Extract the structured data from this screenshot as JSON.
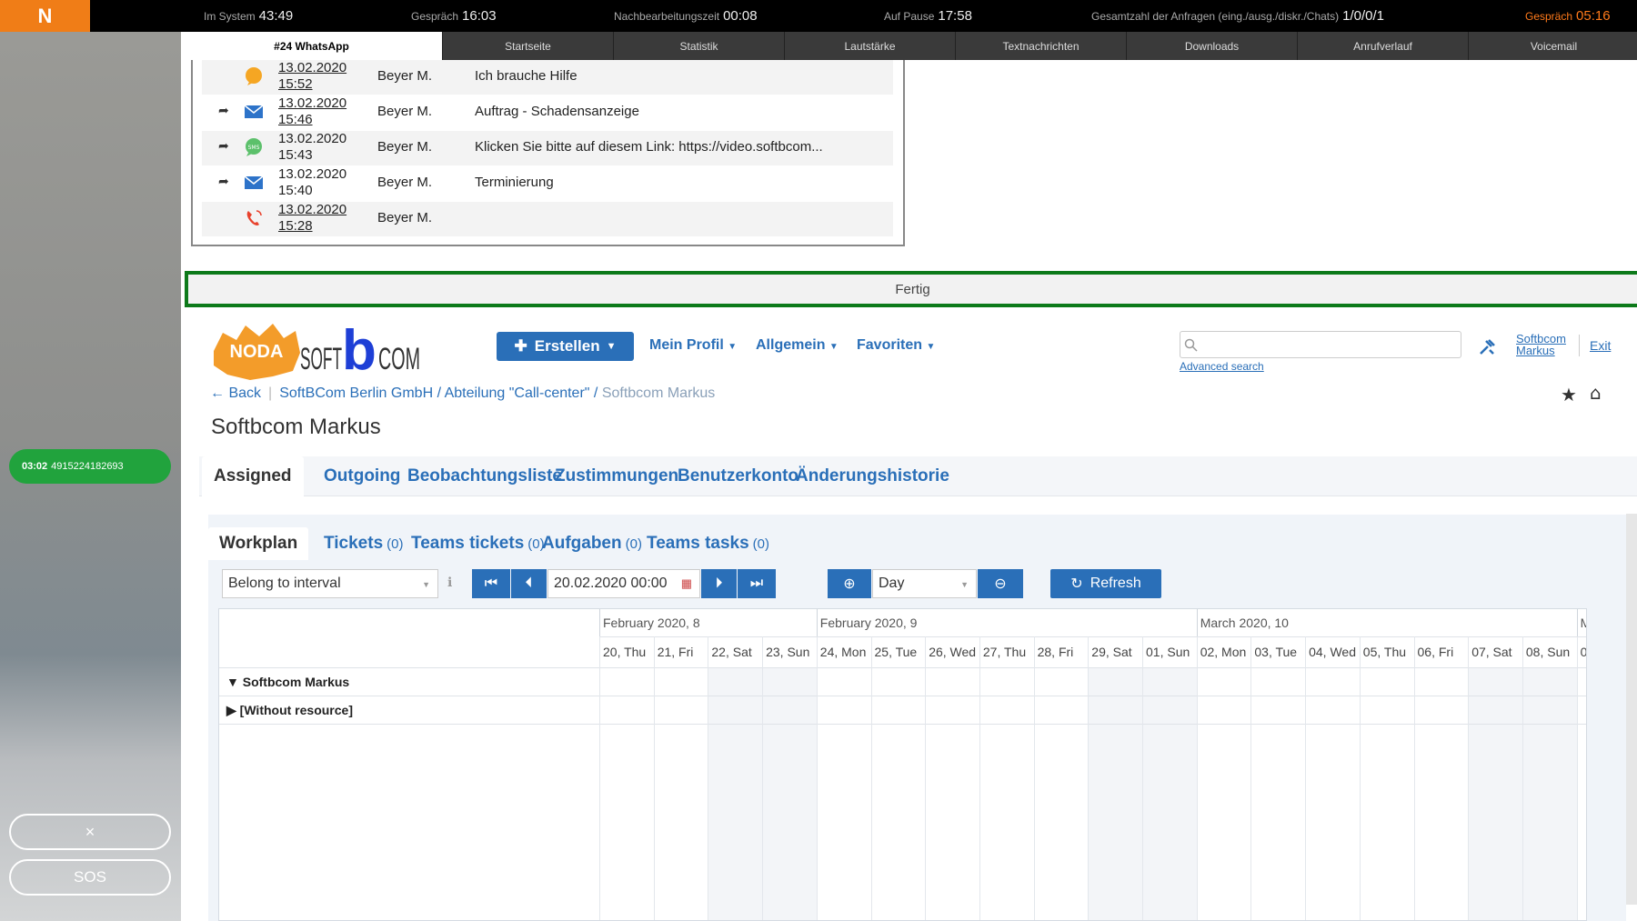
{
  "topbar": {
    "in_system_label": "Im System",
    "in_system_value": "43:49",
    "call_label": "Gespräch",
    "call_value": "16:03",
    "wrapup_label": "Nachbearbeitungszeit",
    "wrapup_value": "00:08",
    "pause_label": "Auf Pause",
    "pause_value": "17:58",
    "requests_label": "Gesamtzahl der Anfragen (eing./ausg./diskr./Chats)",
    "requests_value": "1/0/0/1",
    "status_label": "Gespräch",
    "status_value": "05:16",
    "accent_color": "#f07d17"
  },
  "left": {
    "call_time": "03:02",
    "call_number": "4915224182693",
    "close_icon": "×",
    "sos_label": "SOS"
  },
  "tabs": [
    "#24 WhatsApp",
    "Startseite",
    "Statistik",
    "Lautstärke",
    "Textnachrichten",
    "Downloads",
    "Anrufverlauf",
    "Voicemail"
  ],
  "messages": [
    {
      "icon": "chat-icon",
      "date": "13.02.2020",
      "time": "15:52",
      "name": "Beyer M.",
      "subject": "Ich brauche Hilfe",
      "fwd": ""
    },
    {
      "icon": "mail-icon",
      "date": "13.02.2020",
      "time": "15:46",
      "name": "Beyer M.",
      "subject": "Auftrag - Schadensanzeige",
      "fwd": "➦"
    },
    {
      "icon": "sms-icon",
      "date": "13.02.2020",
      "time": "15:43",
      "name": "Beyer M.",
      "subject": "Klicken Sie bitte auf diesem Link: https://video.softbcom...",
      "fwd": "➦"
    },
    {
      "icon": "mail-icon",
      "date": "13.02.2020",
      "time": "15:40",
      "name": "Beyer M.",
      "subject": "Terminierung",
      "fwd": "➦"
    },
    {
      "icon": "phone-icon",
      "date": "13.02.2020",
      "time": "15:28",
      "name": "Beyer M.",
      "subject": "",
      "fwd": ""
    }
  ],
  "status_text": "Fertig",
  "crm": {
    "logo_noda": "NODA",
    "logo_soft": "SOFT",
    "logo_b": "b",
    "logo_com": "COM",
    "create_label": "Erstellen",
    "nav": [
      "Mein Profil",
      "Allgemein",
      "Favoriten"
    ],
    "search_placeholder": "",
    "advanced_search": "Advanced search",
    "user_line1": "Softbcom",
    "user_line2": "Markus",
    "exit": "Exit",
    "back": "Back",
    "crumb1": "SoftBCom Berlin GmbH",
    "crumb2": "Abteilung \"Call-center\"",
    "crumb3": "Softbcom Markus",
    "title": "Softbcom Markus",
    "main_tabs": [
      "Assigned",
      "Outgoing",
      "Beobachtungsliste",
      "Zustimmungen",
      "Benutzerkonto",
      "Änderungshistorie"
    ],
    "sub_tabs": [
      {
        "label": "Workplan",
        "count": ""
      },
      {
        "label": "Tickets",
        "count": "(0)"
      },
      {
        "label": "Teams tickets",
        "count": "(0)"
      },
      {
        "label": "Aufgaben",
        "count": "(0)"
      },
      {
        "label": "Teams tasks",
        "count": "(0)"
      }
    ],
    "filter": "Belong to interval",
    "date": "20.02.2020 00:00",
    "scale": "Day",
    "refresh": "Refresh",
    "months": [
      "February 2020, 8",
      "February 2020, 9",
      "March 2020, 10",
      "M"
    ],
    "days": [
      "20, Thu",
      "21, Fri",
      "22, Sat",
      "23, Sun",
      "24, Mon",
      "25, Tue",
      "26, Wed",
      "27, Thu",
      "28, Fri",
      "29, Sat",
      "01, Sun",
      "02, Mon",
      "03, Tue",
      "04, Wed",
      "05, Thu",
      "06, Fri",
      "07, Sat",
      "08, Sun",
      "0"
    ],
    "resources": [
      "Softbcom Markus",
      "[Without resource]"
    ]
  }
}
